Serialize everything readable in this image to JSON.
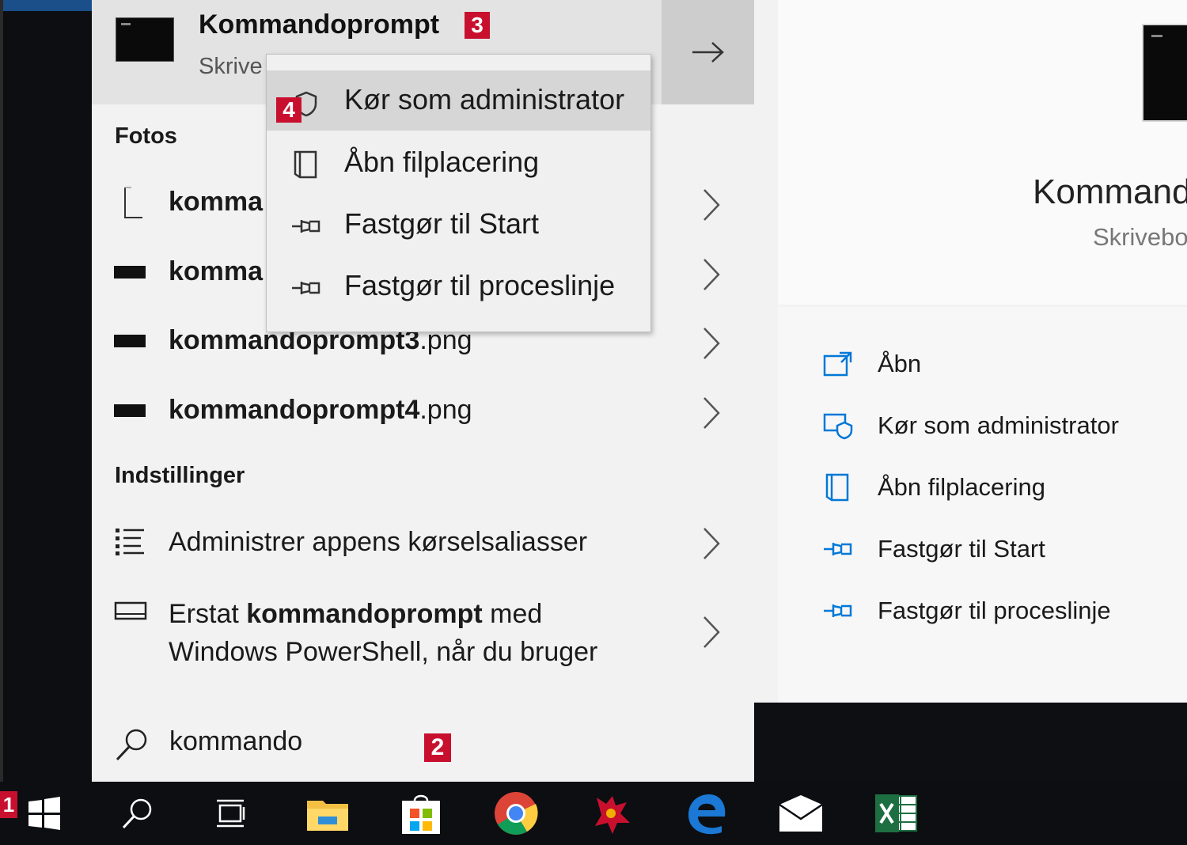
{
  "badges": {
    "one": "1",
    "two": "2",
    "three": "3",
    "four": "4"
  },
  "top_result": {
    "title": "Kommandoprompt",
    "subtitle": "Skrive"
  },
  "context_menu": {
    "items": [
      {
        "label": "Kør som administrator",
        "icon": "shield-icon",
        "active": true
      },
      {
        "label": "Åbn filplacering",
        "icon": "folder-location-icon"
      },
      {
        "label": "Fastgør til Start",
        "icon": "pin-icon"
      },
      {
        "label": "Fastgør til proceslinje",
        "icon": "pin-icon"
      }
    ]
  },
  "sections": {
    "photos": {
      "heading": "Fotos",
      "items": [
        {
          "label": "komma",
          "icon": "document-icon"
        },
        {
          "label": "komma",
          "icon": "image-thumb-icon"
        },
        {
          "label_bold": "kommandoprompt3",
          "label_rest": ".png",
          "icon": "image-thumb-icon"
        },
        {
          "label_bold": "kommandoprompt4",
          "label_rest": ".png",
          "icon": "image-thumb-icon"
        }
      ]
    },
    "settings": {
      "heading": "Indstillinger",
      "items": [
        {
          "label": "Administrer appens kørselsaliasser",
          "icon": "list-icon"
        },
        {
          "label_pre": "Erstat ",
          "label_bold": "kommandoprompt",
          "label_post": " med",
          "label_line2": "Windows PowerShell, når du bruger",
          "icon": "window-icon"
        }
      ]
    }
  },
  "search": {
    "query": "kommando",
    "icon": "search-icon"
  },
  "preview": {
    "title": "Kommand",
    "subtitle": "Skrivebo",
    "actions": [
      {
        "label": "Åbn",
        "icon": "open-icon"
      },
      {
        "label": "Kør som administrator",
        "icon": "shield-icon"
      },
      {
        "label": "Åbn filplacering",
        "icon": "folder-location-icon"
      },
      {
        "label": "Fastgør til Start",
        "icon": "pin-icon"
      },
      {
        "label": "Fastgør til proceslinje",
        "icon": "pin-icon"
      }
    ]
  },
  "taskbar": {
    "items": [
      "windows-start-icon",
      "search-icon",
      "task-view-icon",
      "file-explorer-icon",
      "store-icon",
      "chrome-icon",
      "game-icon",
      "edge-icon",
      "mail-icon",
      "excel-icon"
    ]
  },
  "colors": {
    "accent_blue": "#0078d7",
    "badge_red": "#c8102e",
    "taskbar": "#0c0e12"
  }
}
